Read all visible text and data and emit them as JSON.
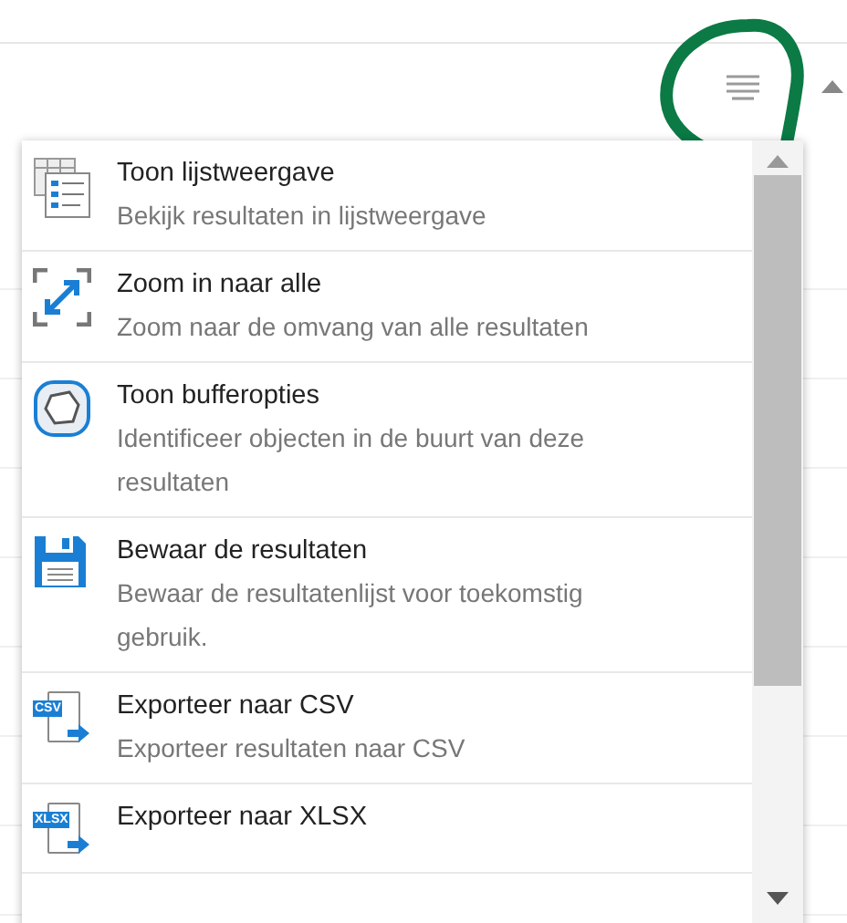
{
  "menu": {
    "items": [
      {
        "kind": "list",
        "title": "Toon lijstweergave",
        "description": "Bekijk resultaten in lijstweergave"
      },
      {
        "kind": "zoom",
        "title": "Zoom in naar alle",
        "description": "Zoom naar de omvang van alle resultaten"
      },
      {
        "kind": "buffer",
        "title": "Toon bufferopties",
        "description": "Identificeer objecten in de buurt van deze resultaten"
      },
      {
        "kind": "save",
        "title": "Bewaar de resultaten",
        "description": "Bewaar de resultatenlijst voor toekomstig gebruik."
      },
      {
        "kind": "export",
        "icon_text": "CSV",
        "title": "Exporteer naar CSV",
        "description": "Exporteer resultaten naar CSV"
      },
      {
        "kind": "export",
        "icon_text": "XLSX",
        "title": "Exporteer naar XLSX"
      }
    ]
  }
}
